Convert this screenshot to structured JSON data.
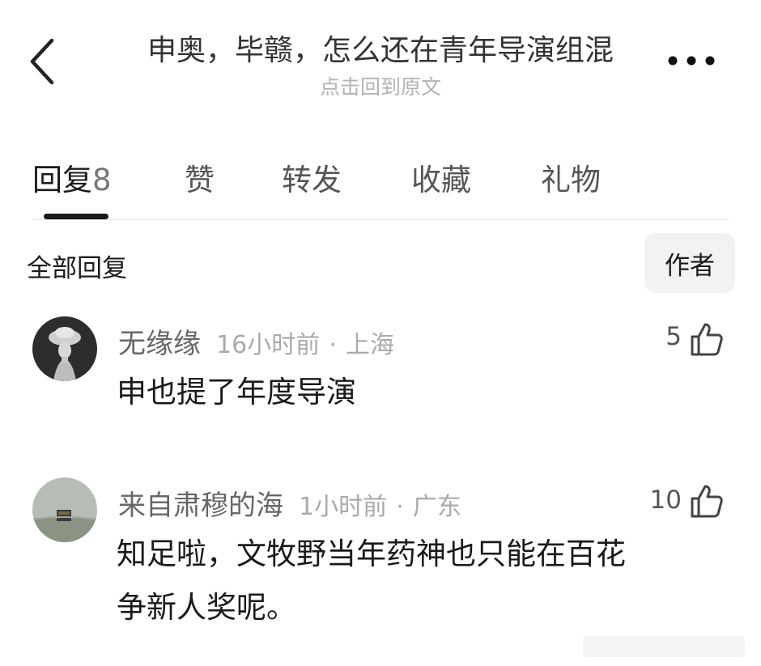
{
  "header": {
    "title": "申奥，毕赣，怎么还在青年导演组混",
    "subtitle": "点击回到原文",
    "back_icon": "chevron-left-icon",
    "more_icon": "more-horizontal-icon"
  },
  "tabs": [
    {
      "label": "回复",
      "count": "8",
      "active": true
    },
    {
      "label": "赞"
    },
    {
      "label": "转发"
    },
    {
      "label": "收藏"
    },
    {
      "label": "礼物"
    }
  ],
  "filter": {
    "section_label": "全部回复",
    "author_button": "作者"
  },
  "comments": [
    {
      "username": "无缘缘",
      "time": "16小时前",
      "separator": "·",
      "location": "上海",
      "likes": "5",
      "text": "申也提了年度导演"
    },
    {
      "username": "来自肃穆的海",
      "time": "1小时前",
      "separator": "·",
      "location": "广东",
      "likes": "10",
      "text_lines": [
        "知足啦，文牧野当年药神也只能在百花",
        "争新人奖呢。"
      ]
    }
  ],
  "colors": {
    "text_primary": "#1a1a1a",
    "text_secondary": "#666666",
    "text_muted": "#aaaaaa",
    "divider": "#e2e2e2",
    "chip_bg": "#f2f2f2"
  }
}
